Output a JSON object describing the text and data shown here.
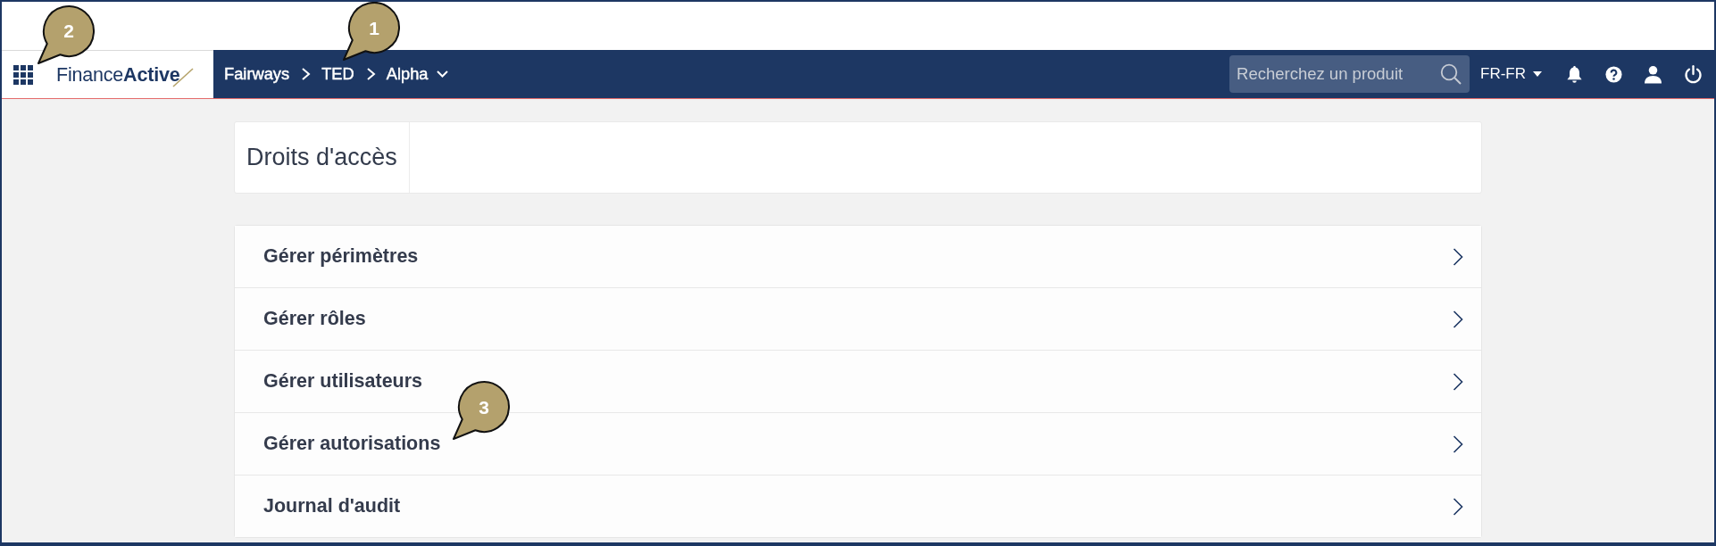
{
  "header": {
    "launcher": {
      "callout": "2"
    },
    "logo": "Finance**Active**",
    "breadcrumb": [
      {
        "label": "Fairways",
        "has_dropdown": false
      },
      {
        "label": "TED",
        "has_dropdown": false,
        "callout": "1"
      },
      {
        "label": "Alpha",
        "has_dropdown": true
      }
    ],
    "search": {
      "placeholder": "Recherchez un produit"
    },
    "language": "FR-FR"
  },
  "page": {
    "title": "Droits d'accès"
  },
  "menu": [
    {
      "label": "Gérer périmètres"
    },
    {
      "label": "Gérer rôles"
    },
    {
      "label": "Gérer utilisateurs"
    },
    {
      "label": "Gérer autorisations",
      "callout": "3"
    },
    {
      "label": "Journal d'audit"
    }
  ]
}
